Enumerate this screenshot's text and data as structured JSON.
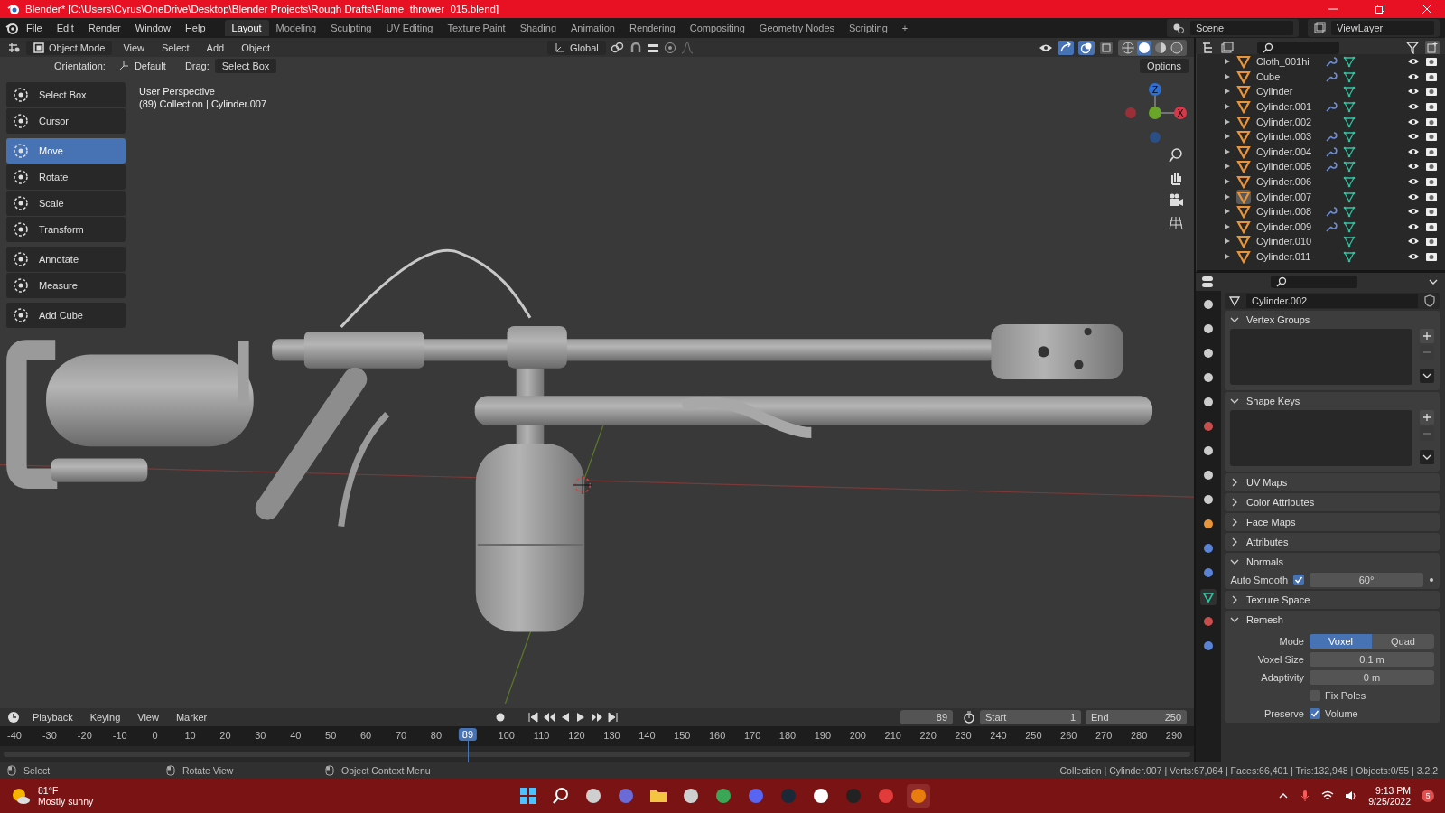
{
  "window": {
    "title": "Blender* [C:\\Users\\Cyrus\\OneDrive\\Desktop\\Blender Projects\\Rough Drafts\\Flame_thrower_015.blend]"
  },
  "menu": [
    "File",
    "Edit",
    "Render",
    "Window",
    "Help"
  ],
  "workspaces": [
    {
      "label": "Layout",
      "selected": true
    },
    {
      "label": "Modeling",
      "selected": false
    },
    {
      "label": "Sculpting",
      "selected": false
    },
    {
      "label": "UV Editing",
      "selected": false
    },
    {
      "label": "Texture Paint",
      "selected": false
    },
    {
      "label": "Shading",
      "selected": false
    },
    {
      "label": "Animation",
      "selected": false
    },
    {
      "label": "Rendering",
      "selected": false
    },
    {
      "label": "Compositing",
      "selected": false
    },
    {
      "label": "Geometry Nodes",
      "selected": false
    },
    {
      "label": "Scripting",
      "selected": false
    }
  ],
  "add_workspace": "+",
  "scene": "Scene",
  "view_layer": "ViewLayer",
  "viewport_header": {
    "mode": "Object Mode",
    "menus": [
      "View",
      "Select",
      "Add",
      "Object"
    ],
    "transform": "Global",
    "orientation_label": "Orientation:",
    "orientation": "Default",
    "drag_label": "Drag:",
    "drag": "Select Box",
    "options": "Options"
  },
  "toolbar": [
    {
      "tools": [
        {
          "label": "Select Box",
          "selected": false
        },
        {
          "label": "Cursor",
          "selected": false
        }
      ]
    },
    {
      "tools": [
        {
          "label": "Move",
          "selected": true
        },
        {
          "label": "Rotate",
          "selected": false
        },
        {
          "label": "Scale",
          "selected": false
        },
        {
          "label": "Transform",
          "selected": false
        }
      ]
    },
    {
      "tools": [
        {
          "label": "Annotate",
          "selected": false
        },
        {
          "label": "Measure",
          "selected": false
        }
      ]
    },
    {
      "tools": [
        {
          "label": "Add Cube",
          "selected": false
        }
      ]
    }
  ],
  "viewport": {
    "view_name": "User Perspective",
    "info": "(89) Collection | Cylinder.007",
    "gizmo": {
      "z": "Z",
      "x": "X"
    }
  },
  "outliner": {
    "items": [
      {
        "name": "Cloth_001hi",
        "has_modifier": true,
        "selected": false
      },
      {
        "name": "Cube",
        "has_modifier": true,
        "selected": false
      },
      {
        "name": "Cylinder",
        "has_modifier": false,
        "selected": false
      },
      {
        "name": "Cylinder.001",
        "has_modifier": true,
        "selected": false
      },
      {
        "name": "Cylinder.002",
        "has_modifier": false,
        "selected": false
      },
      {
        "name": "Cylinder.003",
        "has_modifier": true,
        "selected": false
      },
      {
        "name": "Cylinder.004",
        "has_modifier": true,
        "selected": false
      },
      {
        "name": "Cylinder.005",
        "has_modifier": true,
        "selected": false
      },
      {
        "name": "Cylinder.006",
        "has_modifier": false,
        "selected": false
      },
      {
        "name": "Cylinder.007",
        "has_modifier": false,
        "selected": true
      },
      {
        "name": "Cylinder.008",
        "has_modifier": true,
        "selected": false
      },
      {
        "name": "Cylinder.009",
        "has_modifier": true,
        "selected": false
      },
      {
        "name": "Cylinder.010",
        "has_modifier": false,
        "selected": false
      },
      {
        "name": "Cylinder.011",
        "has_modifier": false,
        "selected": false
      }
    ]
  },
  "properties": {
    "object_name": "Cylinder.002",
    "panels": [
      {
        "title": "Vertex Groups",
        "expanded": true,
        "kind": "list"
      },
      {
        "title": "Shape Keys",
        "expanded": true,
        "kind": "list"
      },
      {
        "title": "UV Maps",
        "expanded": false
      },
      {
        "title": "Color Attributes",
        "expanded": false
      },
      {
        "title": "Face Maps",
        "expanded": false
      },
      {
        "title": "Attributes",
        "expanded": false
      },
      {
        "title": "Normals",
        "expanded": true,
        "kind": "normals",
        "label": "Auto Smooth",
        "checked": true,
        "value": "60°"
      },
      {
        "title": "Texture Space",
        "expanded": false
      },
      {
        "title": "Remesh",
        "expanded": true,
        "kind": "remesh",
        "mode_label": "Mode",
        "modes": [
          {
            "label": "Voxel",
            "selected": true
          },
          {
            "label": "Quad",
            "selected": false
          }
        ],
        "voxel_size_label": "Voxel Size",
        "voxel_size": "0.1 m",
        "adaptivity_label": "Adaptivity",
        "adaptivity": "0 m",
        "fix_poles": {
          "label": "Fix Poles",
          "checked": false
        },
        "preserve_label": "Preserve",
        "volume": {
          "label": "Volume",
          "checked": true
        }
      }
    ]
  },
  "timeline": {
    "menus": [
      "Playback",
      "Keying",
      "View",
      "Marker"
    ],
    "current_frame": "89",
    "playhead": "89",
    "start_label": "Start",
    "start": "1",
    "end_label": "End",
    "end": "250",
    "ticks": [
      "-40",
      "-30",
      "-20",
      "-10",
      "0",
      "10",
      "20",
      "30",
      "40",
      "50",
      "60",
      "70",
      "80",
      "100",
      "110",
      "120",
      "130",
      "140",
      "150",
      "160",
      "170",
      "180",
      "190",
      "200",
      "210",
      "220",
      "230",
      "240",
      "250",
      "260",
      "270",
      "280",
      "290"
    ]
  },
  "status_bar": {
    "hints": [
      "Select",
      "Rotate View",
      "Object Context Menu"
    ],
    "stats": "Collection | Cylinder.007 | Verts:67,064 | Faces:66,401 | Tris:132,948 | Objects:0/55 | 3.2.2"
  },
  "taskbar": {
    "temperature": "81°F",
    "weather": "Mostly sunny",
    "time": "9:13 PM",
    "date": "9/25/2022",
    "badge": "5"
  }
}
